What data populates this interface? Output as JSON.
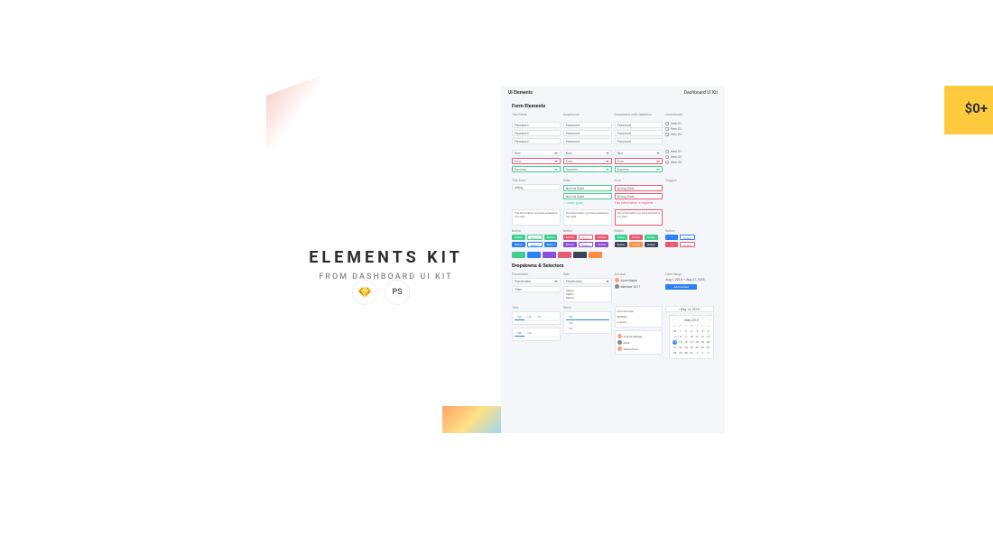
{
  "promo": {
    "tag": "",
    "title": "ELEMENTS KIT",
    "subtitle": "FROM DASHBOARD UI KIT",
    "ps_label": "PS"
  },
  "price": "$0+",
  "preview": {
    "header_left": "UI Elements",
    "header_right": "Dashboard UI Kit",
    "section_form": "Form Elements",
    "section_dd": "Dropdowns & Selectors",
    "cols": {
      "c1": "Text Fields",
      "c2": "Dropdowns",
      "c3": "Dropdowns with Validation",
      "c4": "Checkboxes"
    },
    "field": "Password",
    "field_sel": "Blue",
    "field_err": "Error",
    "field_ok": "Success",
    "check1": "Item 01",
    "check2": "Item 02",
    "check3": "Item 03",
    "comments_label": "Text Area",
    "valid_label": "Valid",
    "normal_label": "Normal State",
    "error_label": "Wrong State",
    "error_hint": "This information is required",
    "textarea_text": "The information you have entered is not valid",
    "btn_label": "Button",
    "dd_label": "Placeholder",
    "filter_label": "Filter",
    "acct1": "Anne Mayer",
    "acct2": "Member 2017",
    "range": "Aug 1, 2018 — Aug 31, 2018",
    "add_btn": "Add Contact",
    "tab1": "Tab",
    "menu_acct": "Your Account",
    "menu_set": "Settings",
    "menu_out": "Log Out",
    "user1": "Joanna Massey",
    "user2": "Anne",
    "user3": "Samuel Doe",
    "cal_month": "May 2018",
    "date_sel": "May 14, 2018",
    "cal_dow": [
      "S",
      "M",
      "T",
      "W",
      "T",
      "F",
      "S"
    ],
    "cal_days": [
      "30",
      "1",
      "2",
      "3",
      "4",
      "5",
      "6",
      "7",
      "8",
      "9",
      "10",
      "11",
      "12",
      "13",
      "14",
      "15",
      "16",
      "17",
      "18",
      "19",
      "20",
      "21",
      "22",
      "23",
      "24",
      "25",
      "26",
      "27",
      "28",
      "29",
      "30",
      "31",
      "1",
      "2",
      "3"
    ]
  }
}
